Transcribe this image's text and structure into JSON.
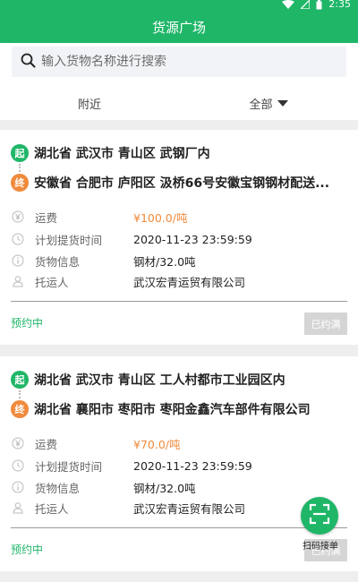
{
  "status_bar": {
    "time": "2:35"
  },
  "header": {
    "title": "货源广场"
  },
  "search": {
    "placeholder": "输入货物名称进行搜索",
    "value": ""
  },
  "tabs": [
    {
      "label": "附近",
      "active": false
    },
    {
      "label": "全部",
      "active": true
    }
  ],
  "colors": {
    "primary": "#1fb668",
    "accent": "#f08a3c",
    "disabled": "#d5d5d5"
  },
  "badges": {
    "from": "起",
    "to": "终"
  },
  "labels": {
    "fee": "运费",
    "pickup_time": "计划提货时间",
    "goods_info": "货物信息",
    "shipper": "托运人"
  },
  "cards": [
    {
      "from": "湖北省 武汉市 青山区 武钢厂内",
      "to": "安徽省 合肥市 庐阳区 汲桥66号安徽宝钢钢材配送...",
      "fee": "¥100.0/吨",
      "pickup_time": "2020-11-23 23:59:59",
      "goods_info": "钢材/32.0吨",
      "shipper": "武汉宏青运贸有限公司",
      "status": "预约中",
      "button": "已约满"
    },
    {
      "from": "湖北省 武汉市 青山区 工人村都市工业园区内",
      "to": "湖北省 襄阳市 枣阳市 枣阳金鑫汽车部件有限公司",
      "fee": "¥70.0/吨",
      "pickup_time": "2020-11-23 23:59:59",
      "goods_info": "钢材/32.0吨",
      "shipper": "武汉宏青运贸有限公司",
      "status": "预约中",
      "button": "已约满"
    }
  ],
  "fab": {
    "label": "扫码接单",
    "icon": "scan-icon"
  }
}
